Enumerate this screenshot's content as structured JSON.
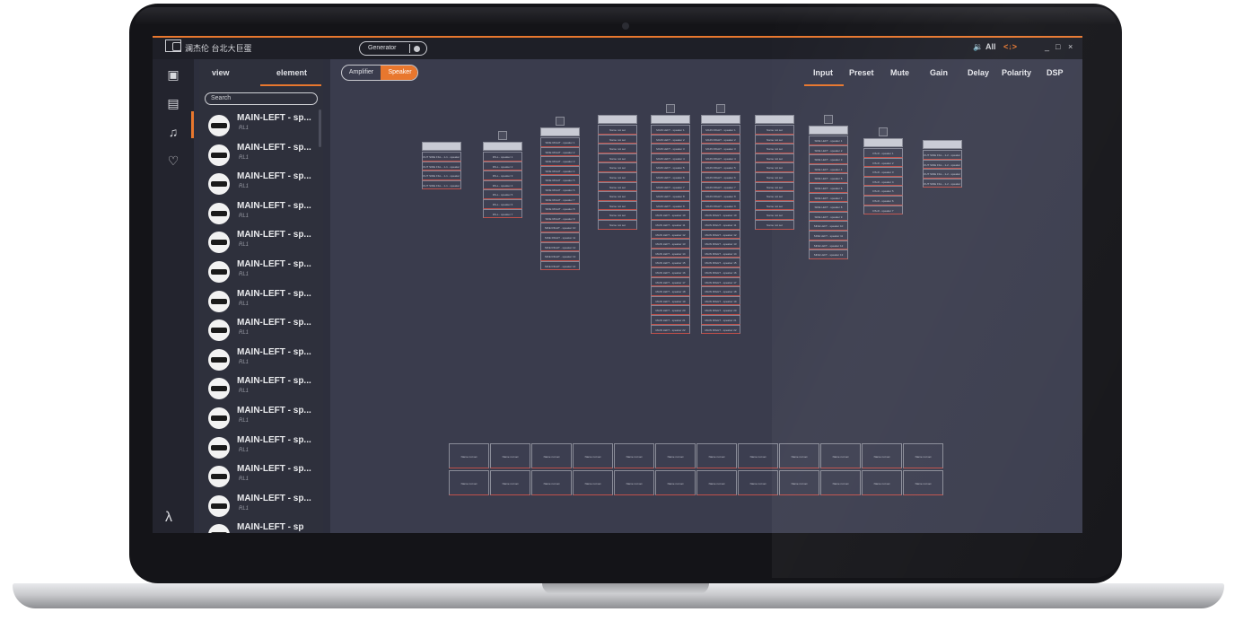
{
  "app": {
    "title": "澜杰伦 台北大巨蛋",
    "generator_label": "Generator",
    "all_label": "All",
    "window_controls": [
      "_",
      "□",
      "×"
    ]
  },
  "sidebar": {
    "icons": [
      "logo-icon",
      "device-icon",
      "list-icon",
      "music-icon",
      "heart-monitor-icon"
    ],
    "footer_symbol": "λ"
  },
  "panel": {
    "tabs": [
      {
        "label": "view"
      },
      {
        "label": "element"
      }
    ],
    "search_placeholder": "Search",
    "items": [
      {
        "name": "MAIN-LEFT - sp...",
        "sub": "RL1"
      },
      {
        "name": "MAIN-LEFT - sp...",
        "sub": "RL1"
      },
      {
        "name": "MAIN-LEFT - sp...",
        "sub": "RL1"
      },
      {
        "name": "MAIN-LEFT - sp...",
        "sub": "RL1"
      },
      {
        "name": "MAIN-LEFT - sp...",
        "sub": "RL1"
      },
      {
        "name": "MAIN-LEFT - sp...",
        "sub": "RL1"
      },
      {
        "name": "MAIN-LEFT - sp...",
        "sub": "RL1"
      },
      {
        "name": "MAIN-LEFT - sp...",
        "sub": "RL1"
      },
      {
        "name": "MAIN-LEFT - sp...",
        "sub": "RL1"
      },
      {
        "name": "MAIN-LEFT - sp...",
        "sub": "RL1"
      },
      {
        "name": "MAIN-LEFT - sp...",
        "sub": "RL1"
      },
      {
        "name": "MAIN-LEFT - sp...",
        "sub": "RL1"
      },
      {
        "name": "MAIN-LEFT - sp...",
        "sub": "RL1"
      },
      {
        "name": "MAIN-LEFT - sp...",
        "sub": "RL1"
      },
      {
        "name": "MAIN-LEFT - sp",
        "sub": ""
      }
    ]
  },
  "main": {
    "mode_toggle": {
      "amplifier": "Amplifier",
      "speaker": "Speaker",
      "active": "Speaker"
    },
    "tabs": [
      {
        "label": "Input",
        "active": true
      },
      {
        "label": "Preset"
      },
      {
        "label": "Mute"
      },
      {
        "label": "Gain"
      },
      {
        "label": "Delay"
      },
      {
        "label": "Polarity"
      },
      {
        "label": "DSP"
      }
    ],
    "columns": [
      {
        "cells": [
          "OUT SIDE FILL - 1-1 - speaker 1",
          "OUT SIDE FILL - 1-1 - speaker 2",
          "OUT SIDE FILL - 1-1 - speaker 3",
          "OUT SIDE FILL - 1-1 - speaker 4"
        ]
      },
      {
        "cells": [
          "DS-L - speaker 1",
          "DS-L - speaker 2",
          "DS-L - speaker 3",
          "DS-L - speaker 4",
          "DS-L - speaker 5",
          "DS-L - speaker 6",
          "DS-L - speaker 7"
        ]
      },
      {
        "cells": [
          "SIDE RIGHT - speaker 1",
          "SIDE RIGHT - speaker 2",
          "SIDE RIGHT - speaker 3",
          "SIDE RIGHT - speaker 4",
          "SIDE RIGHT - speaker 5",
          "SIDE RIGHT - speaker 6",
          "SIDE RIGHT - speaker 7",
          "SIDE RIGHT - speaker 8",
          "SIDE RIGHT - speaker 9",
          "SIDE RIGHT - speaker 10",
          "SIDE RIGHT - speaker 11",
          "SIDE RIGHT - speaker 12",
          "SIDE RIGHT - speaker 13",
          "SIDE RIGHT - speaker 14"
        ]
      },
      {
        "cells": [
          "Name not set",
          "Name not set",
          "Name not set",
          "Name not set",
          "Name not set",
          "Name not set",
          "Name not set",
          "Name not set",
          "Name not set",
          "Name not set",
          "Name not set"
        ]
      },
      {
        "cells": [
          "MAIN LEFT - speaker 1",
          "MAIN LEFT - speaker 2",
          "MAIN LEFT - speaker 3",
          "MAIN LEFT - speaker 4",
          "MAIN LEFT - speaker 5",
          "MAIN LEFT - speaker 6",
          "MAIN LEFT - speaker 7",
          "MAIN LEFT - speaker 8",
          "MAIN LEFT - speaker 9",
          "MAIN LEFT - speaker 10",
          "MAIN LEFT - speaker 11",
          "MAIN LEFT - speaker 12",
          "MAIN LEFT - speaker 13",
          "MAIN LEFT - speaker 14",
          "MAIN LEFT - speaker 15",
          "MAIN LEFT - speaker 16",
          "MAIN LEFT - speaker 17",
          "MAIN LEFT - speaker 18",
          "MAIN LEFT - speaker 19",
          "MAIN LEFT - speaker 20",
          "MAIN LEFT - speaker 21",
          "MAIN LEFT - speaker 22"
        ]
      },
      {
        "cells": [
          "MAIN RIGHT - speaker 1",
          "MAIN RIGHT - speaker 2",
          "MAIN RIGHT - speaker 3",
          "MAIN RIGHT - speaker 4",
          "MAIN RIGHT - speaker 5",
          "MAIN RIGHT - speaker 6",
          "MAIN RIGHT - speaker 7",
          "MAIN RIGHT - speaker 8",
          "MAIN RIGHT - speaker 9",
          "MAIN RIGHT - speaker 10",
          "MAIN RIGHT - speaker 11",
          "MAIN RIGHT - speaker 12",
          "MAIN RIGHT - speaker 13",
          "MAIN RIGHT - speaker 14",
          "MAIN RIGHT - speaker 15",
          "MAIN RIGHT - speaker 16",
          "MAIN RIGHT - speaker 17",
          "MAIN RIGHT - speaker 18",
          "MAIN RIGHT - speaker 19",
          "MAIN RIGHT - speaker 20",
          "MAIN RIGHT - speaker 21",
          "MAIN RIGHT - speaker 22"
        ]
      },
      {
        "cells": [
          "Name not set",
          "Name not set",
          "Name not set",
          "Name not set",
          "Name not set",
          "Name not set",
          "Name not set",
          "Name not set",
          "Name not set",
          "Name not set",
          "Name not set"
        ]
      },
      {
        "cells": [
          "SIDE LEFT - speaker 1",
          "SIDE LEFT - speaker 2",
          "SIDE LEFT - speaker 3",
          "SIDE LEFT - speaker 4",
          "SIDE LEFT - speaker 5",
          "SIDE LEFT - speaker 6",
          "SIDE LEFT - speaker 7",
          "SIDE LEFT - speaker 8",
          "SIDE LEFT - speaker 9",
          "SIDE LEFT - speaker 10",
          "SIDE LEFT - speaker 11",
          "SIDE LEFT - speaker 12",
          "SIDE LEFT - speaker 13"
        ]
      },
      {
        "cells": [
          "DS-R - speaker 1",
          "DS-R - speaker 2",
          "DS-R - speaker 3",
          "DS-R - speaker 4",
          "DS-R - speaker 5",
          "DS-R - speaker 6",
          "DS-R - speaker 7"
        ]
      },
      {
        "cells": [
          "OUT SIDE FILL - 1-2 - speaker 1",
          "OUT SIDE FILL - 1-2 - speaker 2",
          "OUT SIDE FILL - 1-2 - speaker 3",
          "OUT SIDE FILL - 1-2 - speaker 4"
        ]
      }
    ],
    "grid": {
      "rows": [
        [
          "Name not set",
          "Name not set",
          "Name not set",
          "Name not set",
          "Name not set",
          "Name not set",
          "Name not set",
          "Name not set",
          "Name not set",
          "Name not set",
          "Name not set",
          "Name not set"
        ],
        [
          "Name not set",
          "Name not set",
          "Name not set",
          "Name not set",
          "Name not set",
          "Name not set",
          "Name not set",
          "Name not set",
          "Name not set",
          "Name not set",
          "Name not set",
          "Name not set"
        ]
      ]
    }
  },
  "colors": {
    "accent": "#e8772e",
    "background": "#3a3c4d",
    "panel": "#2e303c",
    "topbar": "#1e1f27"
  }
}
